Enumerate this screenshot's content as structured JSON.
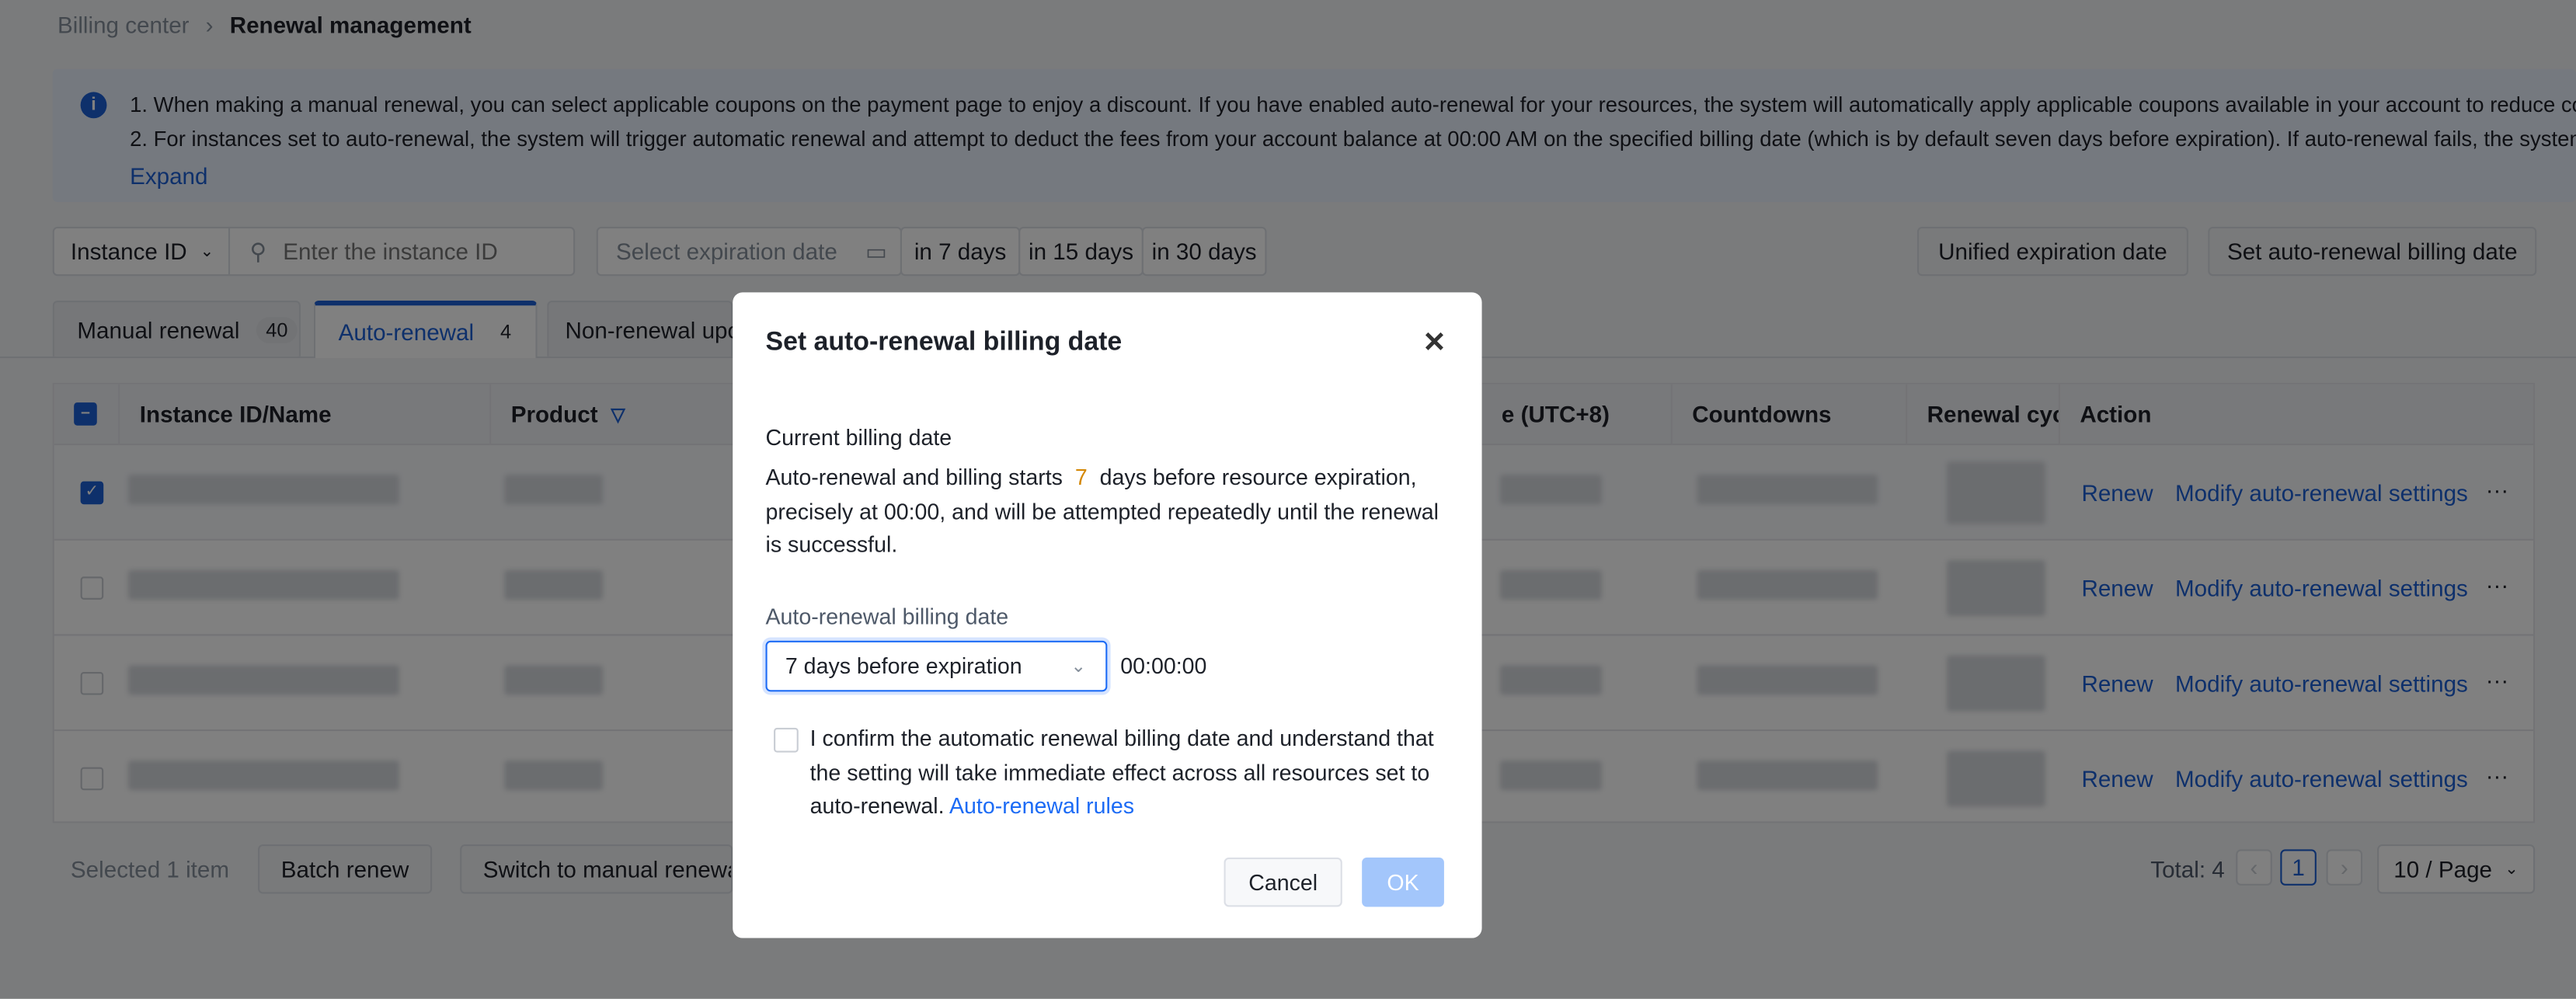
{
  "breadcrumb": {
    "parent": "Billing center",
    "current": "Renewal management"
  },
  "notice": {
    "lines": [
      "1. When making a manual renewal, you can select applicable coupons on the payment page to enjoy a discount. If you have enabled auto-renewal for your resources, the system will automatically apply applicable coupons available in your account to reduce costs.",
      "2. For instances set to auto-renewal, the system will trigger automatic renewal and attempt to deduct the fees from your account balance at 00:00 AM on the specified billing date (which is by default seven days before expiration). If auto-renewal fails, the system will"
    ],
    "expand": "Expand"
  },
  "toolbar": {
    "filter_type": "Instance ID",
    "search_placeholder": "Enter the instance ID",
    "date_placeholder": "Select expiration date",
    "quick": [
      "in 7 days",
      "in 15 days",
      "in 30 days"
    ],
    "unified": "Unified expiration date",
    "set_billing": "Set auto-renewal billing date"
  },
  "tabs": [
    {
      "label": "Manual renewal",
      "count": "40"
    },
    {
      "label": "Auto-renewal",
      "count": "4"
    },
    {
      "label": "Non-renewal upo"
    }
  ],
  "table": {
    "headers": {
      "name": "Instance ID/Name",
      "product": "Product",
      "expiry": "e (UTC+8)",
      "countdown": "Countdowns",
      "cycle": "Renewal cycl",
      "action": "Action"
    },
    "rows": [
      {
        "checked": true
      },
      {
        "checked": false
      },
      {
        "checked": false
      },
      {
        "checked": false
      }
    ],
    "actions": {
      "renew": "Renew",
      "modify": "Modify auto-renewal settings",
      "more": "···"
    }
  },
  "footer": {
    "selected": "Selected 1 item",
    "batch": "Batch renew",
    "switch": "Switch to manual renewal",
    "total": "Total: 4",
    "page": "1",
    "page_size": "10 / Page"
  },
  "modal": {
    "title": "Set auto-renewal billing date",
    "current_label": "Current billing date",
    "desc_pre": "Auto-renewal and billing starts",
    "days": "7",
    "desc_post": "days before resource expiration, precisely at 00:00, and will be attempted repeatedly until the renewal is successful.",
    "field_label": "Auto-renewal billing date",
    "select_value": "7 days before expiration",
    "time": "00:00:00",
    "confirm_text": "I confirm the automatic renewal billing date and understand that the setting will take immediate effect across all resources set to auto-renewal.",
    "rules_link": "Auto-renewal rules",
    "cancel": "Cancel",
    "ok": "OK"
  },
  "colors": {
    "accent": "#1c5fd6",
    "highlight": "#d48806",
    "ok_disabled": "#a3c6fb"
  }
}
